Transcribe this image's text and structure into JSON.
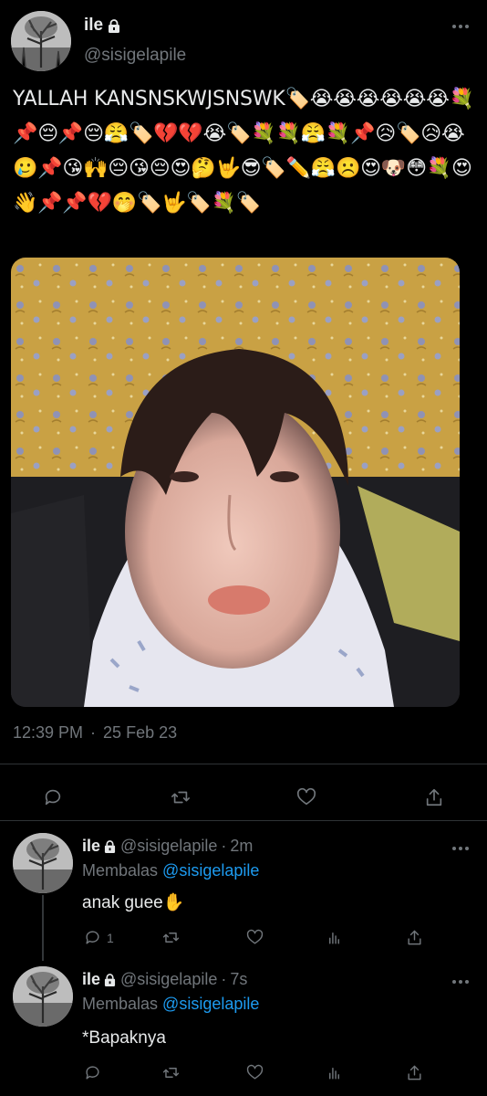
{
  "tweet": {
    "display_name": "ile",
    "handle": "@sisigelapile",
    "text": "YALLAH KANSNSKWJSNSWK🏷️😭😭😭😭😭😭💐📌😔📌😔😤🏷️💔💔😭🏷️💐💐😤💐📌😥🏷️😥😭🥲📌😘🙌😔😘😔😍🤔🤟😎🏷️✏️😤☹️😍🐶😳💐😍👋📌📌💔🤭🏷️🤟🏷️💐🏷️",
    "time": "12:39 PM",
    "separator": "·",
    "date": "25 Feb 23"
  },
  "actions": {
    "reply_icon": "reply-icon",
    "retweet_icon": "retweet-icon",
    "like_icon": "heart-icon",
    "share_icon": "share-icon",
    "analytics_icon": "analytics-icon"
  },
  "replies": [
    {
      "display_name": "ile",
      "handle": "@sisigelapile",
      "separator": "·",
      "time": "2m",
      "replying_to_label": "Membalas",
      "replying_to_handle": "@sisigelapile",
      "text": "anak guee✋",
      "reply_count": "1"
    },
    {
      "display_name": "ile",
      "handle": "@sisigelapile",
      "separator": "·",
      "time": "7s",
      "replying_to_label": "Membalas",
      "replying_to_handle": "@sisigelapile",
      "text": "*Bapaknya"
    }
  ],
  "colors": {
    "background": "#000000",
    "text": "#e7e9ea",
    "muted": "#71767b",
    "link": "#1d9bf0",
    "divider": "#2f3336"
  }
}
